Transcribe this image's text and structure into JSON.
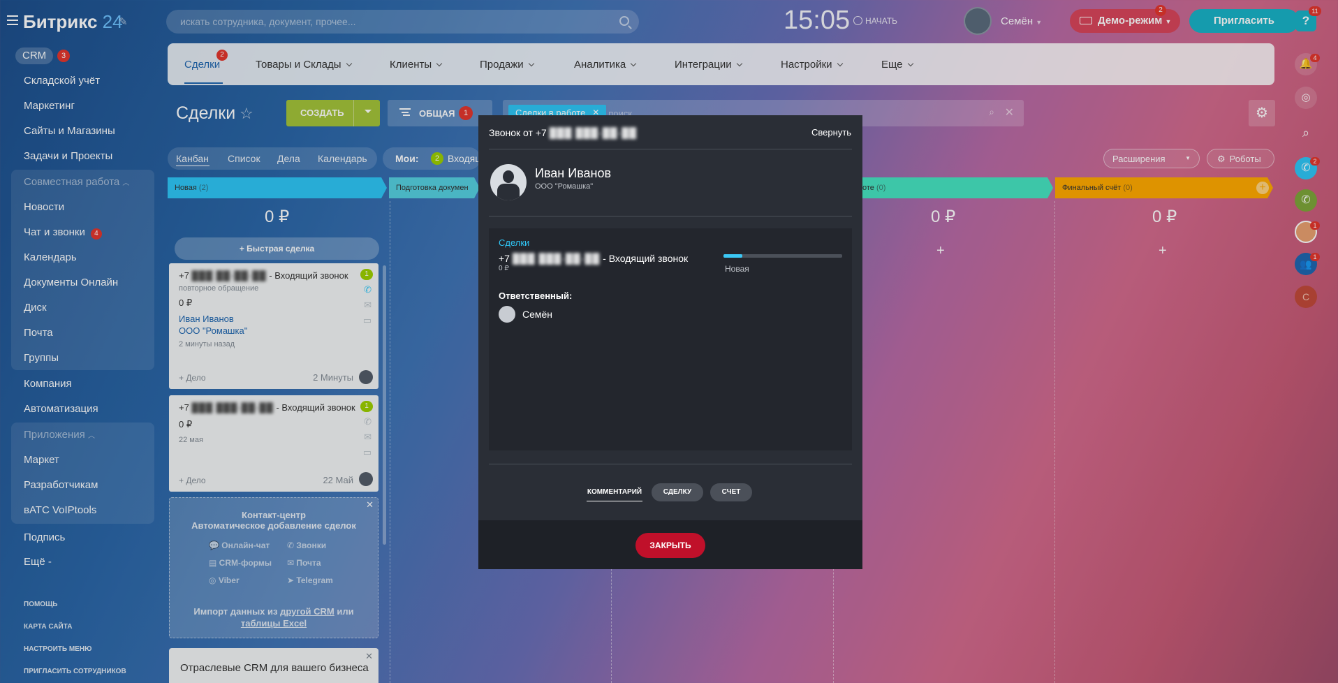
{
  "header": {
    "logo_text": "Битрикс",
    "logo_number": "24",
    "search_placeholder": "искать сотрудника, документ, прочее...",
    "clock": "15:05",
    "start_label": "НАЧАТЬ",
    "user_name": "Семён",
    "demo_label": "Демо-режим",
    "demo_badge": "2",
    "invite_label": "Пригласить",
    "help_label": "?",
    "help_badge": "11"
  },
  "left_menu": {
    "crm_label": "CRM",
    "crm_badge": "3",
    "items_top": [
      "Складской учёт",
      "Маркетинг",
      "Сайты и Магазины",
      "Задачи и Проекты"
    ],
    "group1_title": "Совместная работа",
    "group1_items": [
      "Новости",
      "Чат и звонки",
      "Календарь",
      "Документы Онлайн",
      "Диск",
      "Почта",
      "Группы"
    ],
    "chat_badge": "4",
    "items_mid": [
      "Компания",
      "Автоматизация"
    ],
    "group2_title": "Приложения",
    "group2_items": [
      "Маркет",
      "Разработчикам",
      "вАТС VoIPtools"
    ],
    "items_bottom": [
      "Подпись",
      "Ещё -"
    ],
    "footer": [
      "ПОМОЩЬ",
      "КАРТА САЙТА",
      "НАСТРОИТЬ МЕНЮ",
      "ПРИГЛАСИТЬ СОТРУДНИКОВ"
    ]
  },
  "topnav": {
    "items": [
      "Сделки",
      "Товары и Склады",
      "Клиенты",
      "Продажи",
      "Аналитика",
      "Интеграции",
      "Настройки",
      "Еще"
    ],
    "deals_badge": "2"
  },
  "toolbar": {
    "title": "Сделки",
    "create_label": "СОЗДАТЬ",
    "filter_label": "ОБЩАЯ",
    "filter_badge": "1",
    "filter_tag": "Сделки в работе",
    "filter_search_placeholder": "+ поиск"
  },
  "view": {
    "tabs": [
      "Канбан",
      "Список",
      "Дела",
      "Календарь"
    ],
    "my_label": "Мои:",
    "my_badge": "2",
    "my_text": "Входящ",
    "extensions_label": "Расширения",
    "robots_label": "Роботы"
  },
  "kanban": {
    "columns": [
      {
        "name": "Новая",
        "count": "(2)",
        "sum": "0 ₽",
        "color": "#2fc6f6"
      },
      {
        "name": "Подготовка докумен",
        "count": "",
        "sum": "",
        "color": "#55d0e0"
      },
      {
        "name": "оте",
        "count": "(0)",
        "sum": "0 ₽",
        "color": "#47e4c2"
      },
      {
        "name": "Финальный счёт",
        "count": "(0)",
        "sum": "0 ₽",
        "color": "#ffa900"
      }
    ],
    "quick_deal": "+ Быстрая сделка",
    "cards": [
      {
        "prefix": "+7",
        "title_suffix": "- Входящий звонок",
        "sub": "повторное обращение",
        "sum": "0 ₽",
        "contact": "Иван Иванов",
        "company": "ООО \"Ромашка\"",
        "time": "2 минуты назад",
        "add": "+ Дело",
        "date": "2 Минуты",
        "badge": "1"
      },
      {
        "prefix": "+7",
        "title_suffix": "- Входящий звонок",
        "sub": "",
        "sum": "0 ₽",
        "contact": "",
        "company": "",
        "time": "22 мая",
        "add": "+ Дело",
        "date": "22 Май",
        "badge": "1"
      }
    ],
    "contact_center": {
      "title1": "Контакт-центр",
      "title2": "Автоматическое добавление сделок",
      "channels": [
        "Онлайн-чат",
        "Звонки",
        "CRM-формы",
        "Почта",
        "Viber",
        "Telegram"
      ],
      "import1": "Импорт данных из",
      "import_link1": "другой CRM",
      "import2": "или",
      "import_link2": "таблицы Excel"
    },
    "industry": "Отраслевые CRM для вашего бизнеса"
  },
  "right_bar": {
    "bell_badge": "4",
    "phone_badge": "2",
    "avatar1_badge": "1",
    "group_badge": "1",
    "user_letter": "С"
  },
  "call_popup": {
    "title_prefix": "Звонок от +7",
    "collapse_label": "Свернуть",
    "caller_name": "Иван Иванов",
    "caller_company": "ООО \"Ромашка\"",
    "deals_label": "Сделки",
    "deal_prefix": "+7",
    "deal_suffix": "- Входящий звонок",
    "deal_sum": "0 ₽",
    "stage_label": "Новая",
    "stage_progress": 0.16,
    "responsible_label": "Ответственный:",
    "responsible_name": "Семён",
    "tabs": [
      "КОММЕНТАРИЙ",
      "СДЕЛКУ",
      "СЧЕТ"
    ],
    "close_label": "ЗАКРЫТЬ"
  }
}
